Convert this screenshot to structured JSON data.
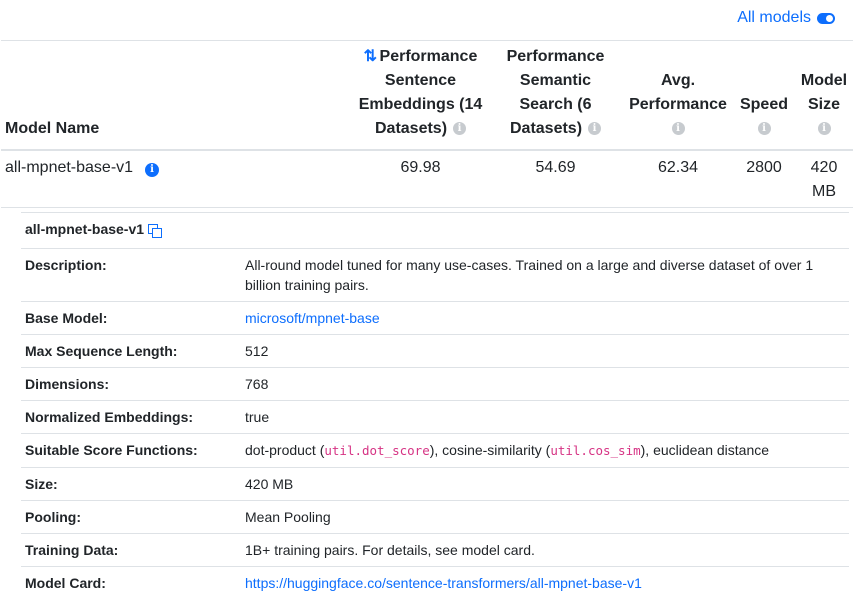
{
  "toggle": {
    "label": "All models",
    "state": "on"
  },
  "table": {
    "headers": {
      "name": "Model Name",
      "sentence": "Performance Sentence Embeddings (14 Datasets)",
      "semantic": "Performance Semantic Search (6 Datasets)",
      "avg": "Avg. Performance",
      "speed": "Speed",
      "size": "Model Size"
    },
    "rows": [
      {
        "name": "all-mpnet-base-v1",
        "sentence": "69.98",
        "semantic": "54.69",
        "avg": "62.34",
        "speed": "2800",
        "size": "420 MB"
      }
    ]
  },
  "details": {
    "model_name": "all-mpnet-base-v1",
    "rows": {
      "description": {
        "label": "Description:",
        "value": "All-round model tuned for many use-cases. Trained on a large and diverse dataset of over 1 billion training pairs."
      },
      "base_model": {
        "label": "Base Model:",
        "value": "microsoft/mpnet-base"
      },
      "max_seq": {
        "label": "Max Sequence Length:",
        "value": "512"
      },
      "dimensions": {
        "label": "Dimensions:",
        "value": "768"
      },
      "normalized": {
        "label": "Normalized Embeddings:",
        "value": "true"
      },
      "score_fns": {
        "label": "Suitable Score Functions:",
        "part1": "dot-product (",
        "code1": "util.dot_score",
        "part2": "), cosine-similarity (",
        "code2": "util.cos_sim",
        "part3": "), euclidean distance"
      },
      "size": {
        "label": "Size:",
        "value": "420 MB"
      },
      "pooling": {
        "label": "Pooling:",
        "value": "Mean Pooling"
      },
      "training": {
        "label": "Training Data:",
        "value": "1B+ training pairs. For details, see model card."
      },
      "model_card": {
        "label": "Model Card:",
        "value": "https://huggingface.co/sentence-transformers/all-mpnet-base-v1"
      }
    }
  },
  "icons": {
    "info": "info-circle-icon",
    "sort": "sort-descending-icon",
    "copy": "copy-icon",
    "toggle": "toggle-on-icon"
  },
  "colors": {
    "accent": "#0d6efd",
    "code": "#d63384",
    "muted_icon": "#c7cbcf"
  }
}
